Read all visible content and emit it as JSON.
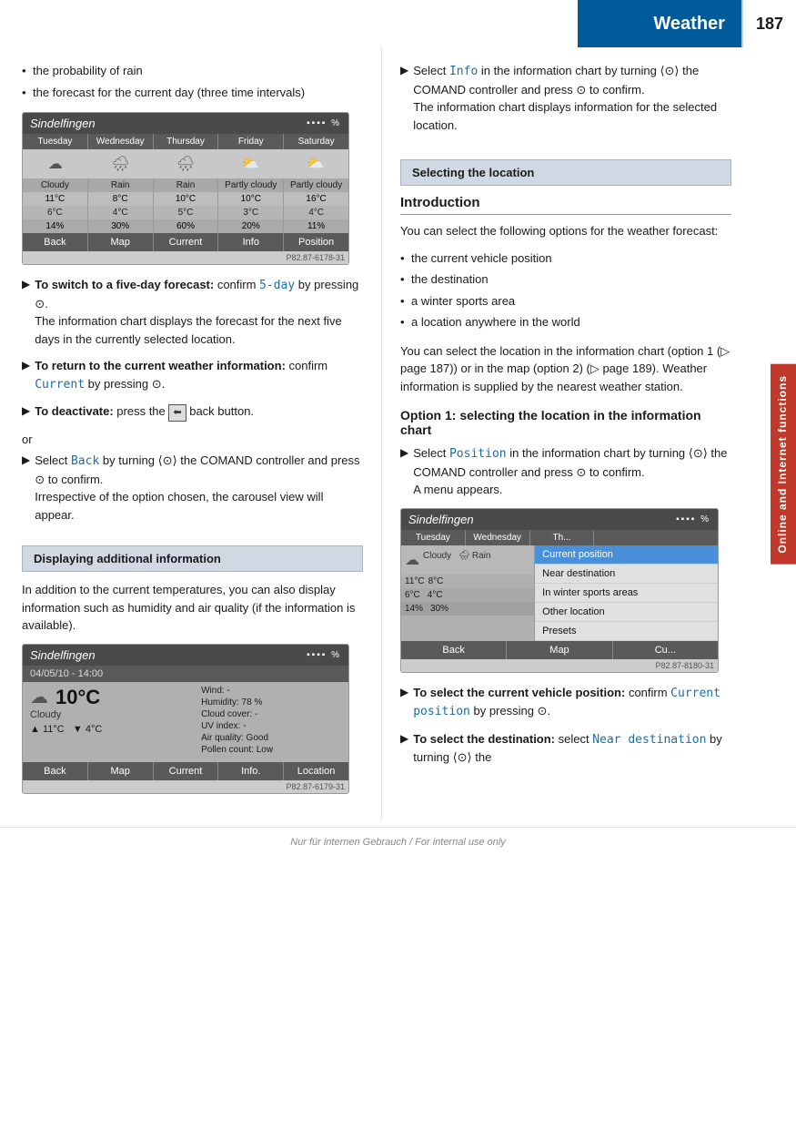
{
  "header": {
    "title": "Weather",
    "page_number": "187"
  },
  "sidebar_tab": "Online and Internet functions",
  "left_col": {
    "bullet_items": [
      "the probability of rain",
      "the forecast for the current day (three time intervals)"
    ],
    "screen1": {
      "title": "Sindelfingen",
      "icons_label": "▪▪▪▪ %",
      "days": [
        "Tuesday",
        "Wednesday",
        "Thursday",
        "Friday",
        "Saturday"
      ],
      "conditions": [
        "Cloudy",
        "Rain",
        "Rain",
        "Partly cloudy",
        "Partly cloudy"
      ],
      "high_temps": [
        "11°C",
        "8°C",
        "10°C",
        "10°C",
        "16°C"
      ],
      "low_temps": [
        "6°C",
        "4°C",
        "5°C",
        "3°C",
        "4°C"
      ],
      "rain_pcts": [
        "14%",
        "30%",
        "60%",
        "20%",
        "11%"
      ],
      "footer_btns": [
        "Back",
        "Map",
        "Current",
        "Info",
        "Position"
      ],
      "caption": "P82.87-6178-31"
    },
    "instructions": [
      {
        "id": "inst1",
        "arrow": true,
        "bold_prefix": "To switch to a five-day forecast:",
        "text": " confirm ",
        "code": "5-day",
        "text2": " by pressing ",
        "symbol": "⊙",
        "text3": ".",
        "extra": "The information chart displays the forecast for the next five days in the currently selected location."
      },
      {
        "id": "inst2",
        "arrow": true,
        "bold_prefix": "To return to the current weather information:",
        "text": " confirm ",
        "code": "Current",
        "text2": " by pressing ",
        "symbol": "⊙",
        "text3": "."
      },
      {
        "id": "inst3",
        "arrow": true,
        "bold_prefix": "To deactivate:",
        "text": " press the",
        "back_icon": true,
        "text2": "back button."
      },
      {
        "id": "inst4",
        "or": true
      },
      {
        "id": "inst5",
        "arrow": true,
        "text": "Select ",
        "code": "Back",
        "text2": " by turning ",
        "symbol": "⟨⊙⟩",
        "text3": " the COMAND controller and press ",
        "symbol2": "⊙",
        "text4": " to confirm.",
        "extra": "Irrespective of the option chosen, the carousel view will appear."
      }
    ],
    "section_display": {
      "label": "Displaying additional information"
    },
    "display_text": "In addition to the current temperatures, you can also display information such as humidity and air quality (if the information is available).",
    "screen2": {
      "title": "Sindelfingen",
      "icons_label": "▪▪▪▪ %",
      "date_time": "04/05/10 - 14:00",
      "big_temp": "10°C",
      "condition": "Cloudy",
      "high_temp": "11°C",
      "low_temp": "4°C",
      "wind": "Wind: -",
      "humidity": "Humidity: 78 %",
      "cloud_cover": "Cloud cover: -",
      "uv_index": "UV index: -",
      "air_quality": "Air quality: Good",
      "pollen_count": "Pollen count: Low",
      "footer_btns": [
        "Back",
        "Map",
        "Current",
        "Info.",
        "Location"
      ],
      "caption": "P82.87-6179-31"
    }
  },
  "right_col": {
    "select_info_instruction": {
      "arrow": true,
      "text": "Select ",
      "code": "Info",
      "text2": " in the information chart by turning ",
      "symbol": "⟨⊙⟩",
      "text3": " the COMAND controller and press ",
      "symbol2": "⊙",
      "text4": " to confirm.",
      "extra": "The information chart displays information for the selected location."
    },
    "section_location": {
      "label": "Selecting the location"
    },
    "intro_heading": "Introduction",
    "intro_text": "You can select the following options for the weather forecast:",
    "intro_bullets": [
      "the current vehicle position",
      "the destination",
      "a winter sports area",
      "a location anywhere in the world"
    ],
    "intro_para": "You can select the location in the information chart (option 1 (▷ page 187)) or in the map (option 2) (▷ page 189). Weather information is supplied by the nearest weather station.",
    "option_heading": "Option 1: selecting the location in the information chart",
    "option_instruction": {
      "arrow": true,
      "text": "Select ",
      "code": "Position",
      "text2": " in the information chart by turning ",
      "symbol": "⟨⊙⟩",
      "text3": " the COMAND controller and press ",
      "symbol2": "⊙",
      "text4": " to confirm.",
      "extra": "A menu appears."
    },
    "screen3": {
      "title": "Sindelfingen",
      "icons_label": "▪▪▪▪ %",
      "days": [
        "Tuesday",
        "Wednesday",
        "Th..."
      ],
      "conditions": [
        "Cloudy",
        "Rain"
      ],
      "high_temps": [
        "11°C",
        "8°C"
      ],
      "low_temps": [
        "6°C",
        "4°C"
      ],
      "rain_pcts": [
        "14%",
        "30%"
      ],
      "menu_items": [
        "Current position",
        "Near destination",
        "In winter sports areas",
        "Other location",
        "Presets"
      ],
      "footer_btns": [
        "Back",
        "Map",
        "Cu..."
      ],
      "caption": "P82.87-8180-31"
    },
    "position_instructions": [
      {
        "id": "pos1",
        "arrow": true,
        "bold_prefix": "To select the current vehicle position:",
        "text": " confirm ",
        "code": "Current position",
        "text2": " by pressing ",
        "symbol": "⊙",
        "text3": "."
      },
      {
        "id": "pos2",
        "arrow": true,
        "bold_prefix": "To select the destination:",
        "text": " select ",
        "code": "Near destination",
        "text2": " by turning ",
        "symbol": "⟨⊙⟩",
        "text3": " the"
      }
    ]
  },
  "watermark": "Nur für internen Gebrauch / For internal use only"
}
